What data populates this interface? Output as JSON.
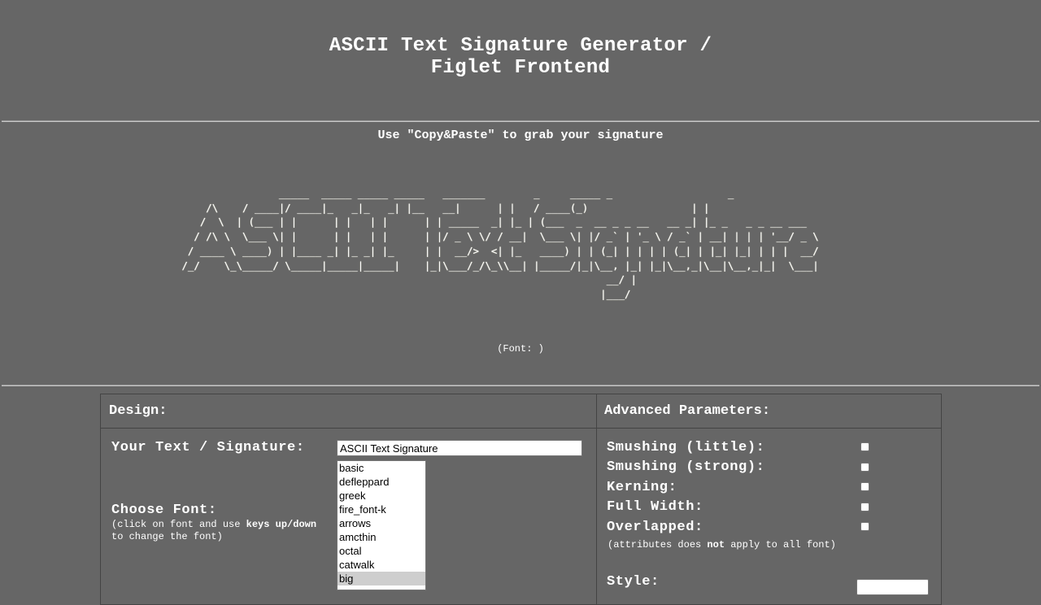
{
  "header": {
    "title_line1": "ASCII Text Signature Generator /",
    "title_line2": "Figlet Frontend"
  },
  "output": {
    "instruction": "Use \"Copy&Paste\" to grab your signature",
    "ascii_art": "                 _____  _____ _____ _____   _______        _     _____ _                   _                  \n     /\\    / ____|/ ____|_   _|_   _| |__   __|      | |   / ____(_)                 | |                 \n    /  \\  | (___ | |      | |   | |      | | _____  _| |_ | (___  _  __ _ _ __   __ _| |_ _   _ _ __ ___ \n   / /\\ \\  \\___ \\| |      | |   | |      | |/ _ \\ \\/ / __|  \\___ \\| |/ _` | '_ \\ / _` | __| | | | '__/ _ \\\n  / ____ \\ ____) | |____ _| |_ _| |_     | |  __/>  <| |_   ____) | | (_| | | | | (_| | |_| |_| | | |  __/\n /_/    \\_\\_____/ \\_____|_____|_____|    |_|\\___/_/\\_\\\\__| |_____/|_|\\__, |_| |_|\\__,_|\\__|\\__,_|_|  \\___|\n                                                                       __/ |                              \n                                                                      |___/                               ",
    "font_note": "(Font: )"
  },
  "design": {
    "heading": "Design:",
    "text_label": "Your Text / Signature:",
    "text_value": "ASCII Text Signature",
    "font_label": "Choose Font:",
    "font_hint_line1_prefix": "(click on font and use ",
    "font_hint_keys": "keys up/down",
    "font_hint_line2": "to change the font)",
    "fonts": [
      "basic",
      "defleppard",
      "greek",
      "fire_font-k",
      "arrows",
      "amcthin",
      "octal",
      "catwalk",
      "big"
    ],
    "selected_font": "big"
  },
  "advanced": {
    "heading": "Advanced Parameters:",
    "options": [
      {
        "label": "Smushing (little):",
        "checked": false
      },
      {
        "label": "Smushing (strong):",
        "checked": false
      },
      {
        "label": "Kerning:",
        "checked": false
      },
      {
        "label": "Full Width:",
        "checked": false
      },
      {
        "label": "Overlapped:",
        "checked": false
      }
    ],
    "note_prefix": "(attributes does ",
    "note_emphasis": "not",
    "note_suffix": " apply to all font)",
    "style_label": "Style:"
  }
}
